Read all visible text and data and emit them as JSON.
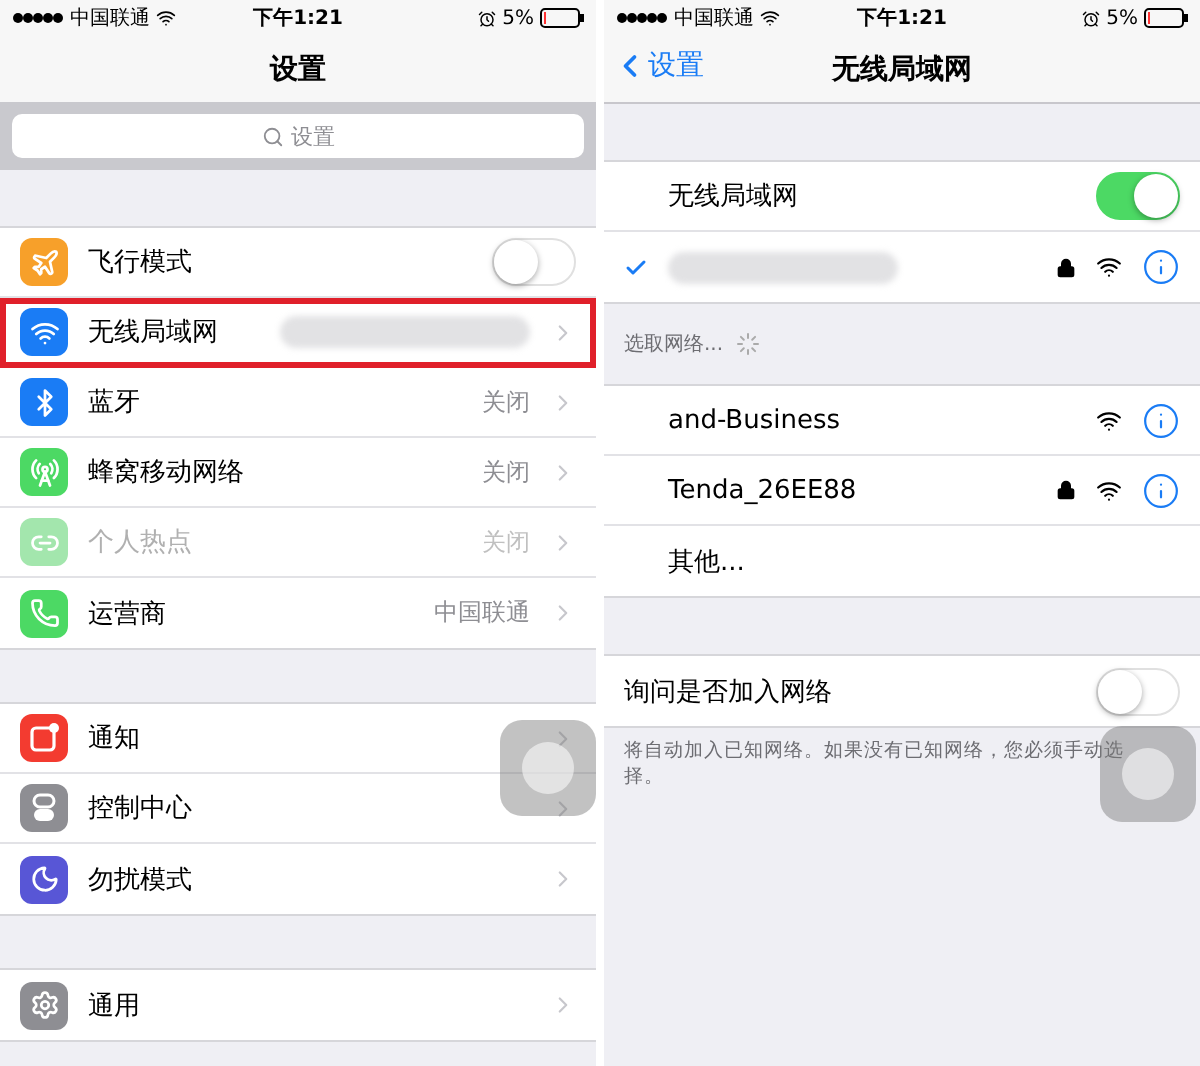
{
  "left_screen": {
    "status_bar": {
      "carrier": "中国联通",
      "time": "下午1:21",
      "battery": "5%"
    },
    "title": "设置",
    "search": {
      "placeholder": "设置"
    },
    "groups": [
      [
        {
          "label": "飞行模式",
          "kind": "toggle",
          "on": false,
          "color": "#f7a02a"
        },
        {
          "label": "无线局域网",
          "kind": "link",
          "value_hidden": true,
          "highlighted": true,
          "color": "#1a7cf5"
        },
        {
          "label": "蓝牙",
          "kind": "link",
          "value": "关闭",
          "color": "#1a7cf5"
        },
        {
          "label": "蜂窝移动网络",
          "kind": "link",
          "value": "关闭",
          "color": "#4cd964"
        },
        {
          "label": "个人热点",
          "kind": "link",
          "value": "关闭",
          "disabled": true,
          "color": "#a3e6ad"
        },
        {
          "label": "运营商",
          "kind": "link",
          "value": "中国联通",
          "color": "#4cd964"
        }
      ],
      [
        {
          "label": "通知",
          "kind": "link",
          "color": "#f33b30"
        },
        {
          "label": "控制中心",
          "kind": "link",
          "color": "#8e8e93"
        },
        {
          "label": "勿扰模式",
          "kind": "link",
          "color": "#5856d6"
        }
      ],
      [
        {
          "label": "通用",
          "kind": "link",
          "color": "#8e8e93"
        }
      ]
    ]
  },
  "right_screen": {
    "status_bar": {
      "carrier": "中国联通",
      "time": "下午1:21",
      "battery": "5%"
    },
    "back": "设置",
    "title": "无线局域网",
    "wifi_toggle": {
      "label": "无线局域网",
      "on": true
    },
    "connected": {
      "checked": true,
      "locked": true
    },
    "section_header": "选取网络...",
    "networks": [
      {
        "name": "and-Business",
        "locked": false
      },
      {
        "name": "Tenda_26EE88",
        "locked": true
      },
      {
        "name": "其他...",
        "kind": "other"
      }
    ],
    "ask_to_join": {
      "label": "询问是否加入网络",
      "on": false
    },
    "footer": "将自动加入已知网络。如果没有已知网络，您必须手动选择。"
  }
}
